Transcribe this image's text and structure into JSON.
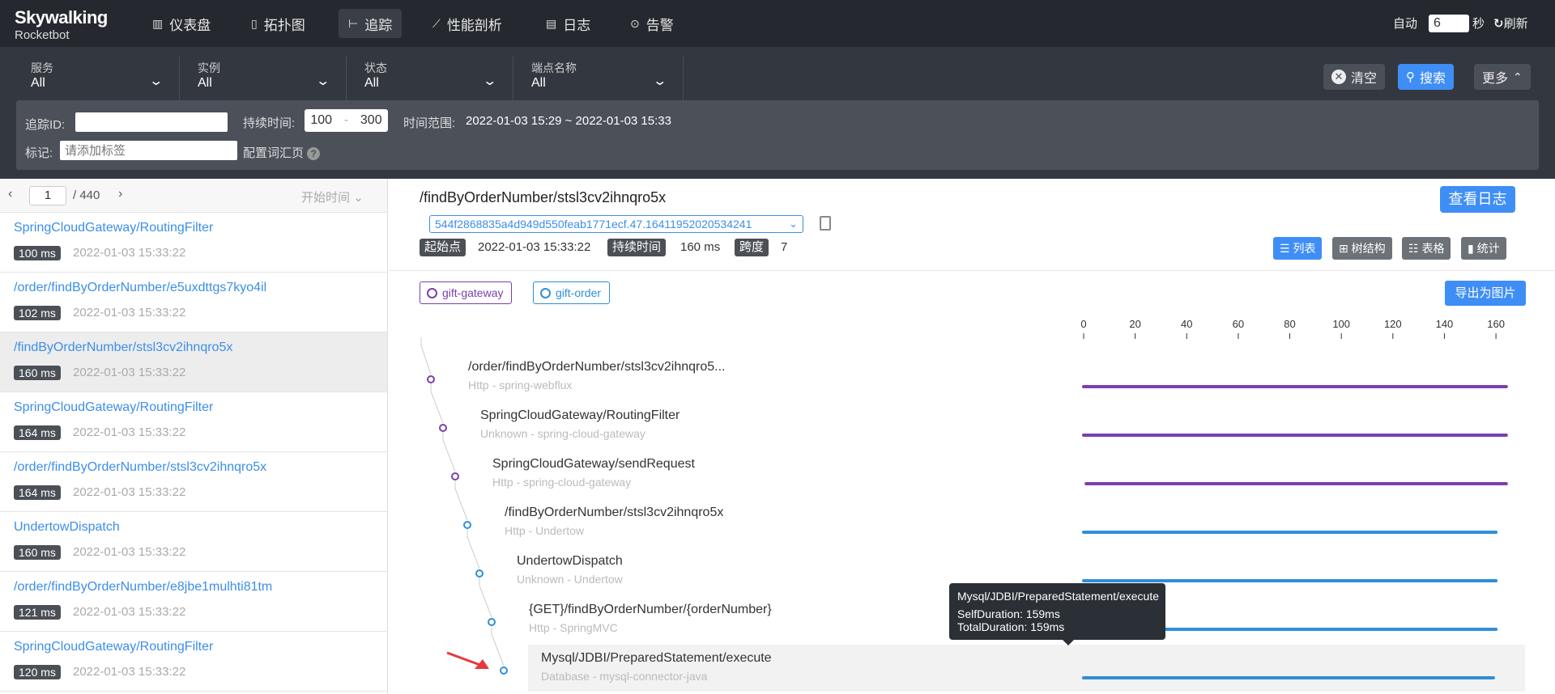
{
  "nav": {
    "logo_title": "Skywalking",
    "logo_sub": "Rocketbot",
    "items": [
      {
        "label": "仪表盘",
        "icon": "chart-icon"
      },
      {
        "label": "拓扑图",
        "icon": "topology-icon"
      },
      {
        "label": "追踪",
        "icon": "trace-icon"
      },
      {
        "label": "性能剖析",
        "icon": "profile-icon"
      },
      {
        "label": "日志",
        "icon": "log-icon"
      },
      {
        "label": "告警",
        "icon": "alarm-icon"
      }
    ],
    "active_index": 2,
    "auto_label": "自动",
    "auto_value": "6",
    "seconds_label": "秒",
    "refresh_label": "刷新"
  },
  "filters": {
    "selects": [
      {
        "label": "服务",
        "value": "All"
      },
      {
        "label": "实例",
        "value": "All"
      },
      {
        "label": "状态",
        "value": "All"
      },
      {
        "label": "端点名称",
        "value": "All"
      }
    ],
    "clear_label": "清空",
    "search_label": "搜索",
    "more_label": "更多",
    "trace_id_label": "追踪ID:",
    "trace_id_value": "",
    "duration_label": "持续时间:",
    "duration_min": "100",
    "duration_sep": "-",
    "duration_max": "300",
    "time_range_label": "时间范围:",
    "time_range_value": "2022-01-03 15:29 ~ 2022-01-03 15:33",
    "tags_label": "标记:",
    "tags_placeholder": "请添加标签",
    "config_label": "配置词汇页"
  },
  "pager": {
    "page": "1",
    "total": "/ 440",
    "sort_label": "开始时间"
  },
  "traces": [
    {
      "name": "SpringCloudGateway/RoutingFilter",
      "duration": "100 ms",
      "time": "2022-01-03 15:33:22"
    },
    {
      "name": "/order/findByOrderNumber/e5uxdttgs7kyo4il",
      "duration": "102 ms",
      "time": "2022-01-03 15:33:22"
    },
    {
      "name": "/findByOrderNumber/stsl3cv2ihnqro5x",
      "duration": "160 ms",
      "time": "2022-01-03 15:33:22"
    },
    {
      "name": "SpringCloudGateway/RoutingFilter",
      "duration": "164 ms",
      "time": "2022-01-03 15:33:22"
    },
    {
      "name": "/order/findByOrderNumber/stsl3cv2ihnqro5x",
      "duration": "164 ms",
      "time": "2022-01-03 15:33:22"
    },
    {
      "name": "UndertowDispatch",
      "duration": "160 ms",
      "time": "2022-01-03 15:33:22"
    },
    {
      "name": "/order/findByOrderNumber/e8jbe1mulhti81tm",
      "duration": "121 ms",
      "time": "2022-01-03 15:33:22"
    },
    {
      "name": "SpringCloudGateway/RoutingFilter",
      "duration": "120 ms",
      "time": "2022-01-03 15:33:22"
    }
  ],
  "detail": {
    "title": "/findByOrderNumber/stsl3cv2ihnqro5x",
    "trace_id": "544f2868835a4d949d550feab1771ecf.47.16411952020534241",
    "start_label": "起始点",
    "start_value": "2022-01-03 15:33:22",
    "duration_label": "持续时间",
    "duration_value": "160 ms",
    "span_label": "跨度",
    "span_value": "7",
    "view_log_label": "查看日志",
    "views": [
      "列表",
      "树结构",
      "表格",
      "统计"
    ],
    "active_view": 0,
    "export_label": "导出为图片",
    "services": [
      {
        "name": "gift-gateway",
        "color": "#7b3fb0"
      },
      {
        "name": "gift-order",
        "color": "#2f8fd8"
      }
    ],
    "axis_ticks": [
      0,
      20,
      40,
      60,
      80,
      100,
      120,
      140,
      160
    ]
  },
  "spans": [
    {
      "name": "/order/findByOrderNumber/stsl3cv2ihnqro5...",
      "sub": "Http - spring-webflux",
      "service": 0,
      "start": 0,
      "end": 164
    },
    {
      "name": "SpringCloudGateway/RoutingFilter",
      "sub": "Unknown - spring-cloud-gateway",
      "service": 0,
      "start": 0,
      "end": 164
    },
    {
      "name": "SpringCloudGateway/sendRequest",
      "sub": "Http - spring-cloud-gateway",
      "service": 0,
      "start": 1,
      "end": 164
    },
    {
      "name": "/findByOrderNumber/stsl3cv2ihnqro5x",
      "sub": "Http - Undertow",
      "service": 1,
      "start": 0,
      "end": 160
    },
    {
      "name": "UndertowDispatch",
      "sub": "Unknown - Undertow",
      "service": 1,
      "start": 0,
      "end": 160
    },
    {
      "name": "{GET}/findByOrderNumber/{orderNumber}",
      "sub": "Http - SpringMVC",
      "service": 1,
      "start": 0,
      "end": 160
    },
    {
      "name": "Mysql/JDBI/PreparedStatement/execute",
      "sub": "Database - mysql-connector-java",
      "service": 1,
      "start": 0,
      "end": 159
    }
  ],
  "tooltip": {
    "title": "Mysql/JDBI/PreparedStatement/execute",
    "self": "SelfDuration: 159ms",
    "total": "TotalDuration: 159ms"
  },
  "colors": {
    "accent": "#3f8ef6",
    "link": "#3c8ee8",
    "gateway": "#7b3fb0",
    "order": "#2f8fd8",
    "arrow": "#e8373d"
  }
}
